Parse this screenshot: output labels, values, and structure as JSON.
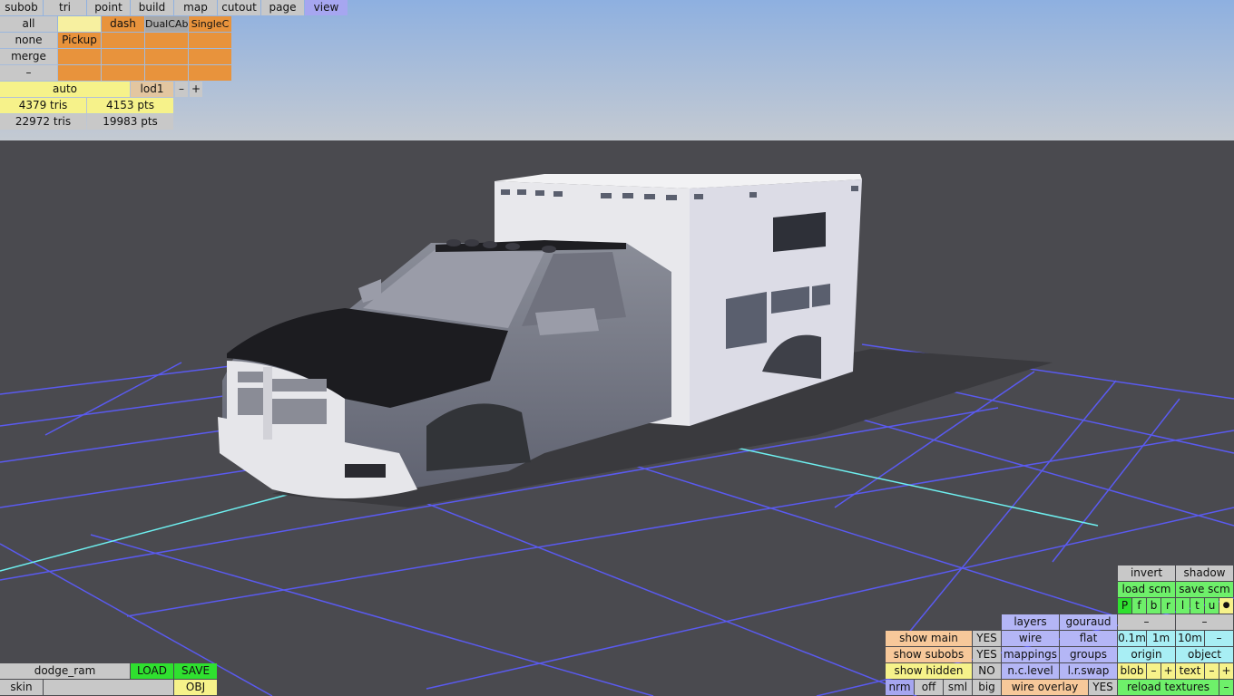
{
  "top_menu": [
    "subob",
    "tri",
    "point",
    "build",
    "map",
    "cutout",
    "page",
    "view"
  ],
  "subob_grid": {
    "row1": [
      "all",
      "",
      "dash",
      "DualCAb",
      "SingleC"
    ],
    "row2": [
      "none",
      "Pickup",
      "",
      "",
      ""
    ],
    "row3": [
      "merge",
      "",
      "",
      "",
      ""
    ],
    "row4": [
      "–",
      "",
      "",
      "",
      ""
    ]
  },
  "lod": {
    "mode": "auto",
    "level": "lod1",
    "minus": "–",
    "plus": "+"
  },
  "stats": {
    "tris_sel": "4379 tris",
    "pts_sel": "4153 pts",
    "tris_total": "22972 tris",
    "pts_total": "19983 pts"
  },
  "file": {
    "name": "dodge_ram",
    "load": "LOAD",
    "save": "SAVE",
    "skin": "skin",
    "skin_value": "",
    "format": "OBJ"
  },
  "right_panel": {
    "invert": "invert",
    "shadow": "shadow",
    "load_scm": "load scm",
    "save_scm": "save scm",
    "letters": [
      "P",
      "f",
      "b",
      "r",
      "l",
      "t",
      "u",
      "●"
    ],
    "layers": "layers",
    "gouraud": "gouraud",
    "dash1": "–",
    "dash2": "–",
    "show_main": "show main",
    "show_main_val": "YES",
    "wire": "wire",
    "flat": "flat",
    "scale_01": "0.1m",
    "scale_1": "1m",
    "scale_10": "10m",
    "scale_minus": "–",
    "show_subobs": "show subobs",
    "show_subobs_val": "YES",
    "mappings": "mappings",
    "groups": "groups",
    "origin": "origin",
    "object": "object",
    "show_hidden": "show hidden",
    "show_hidden_val": "NO",
    "nc_level": "n.c.level",
    "lr_swap": "l.r.swap",
    "blob": "blob",
    "blob_minus": "–",
    "blob_plus": "+",
    "text": "text",
    "text_minus": "–",
    "text_plus": "+",
    "nrm": "nrm",
    "off": "off",
    "sml": "sml",
    "big": "big",
    "wire_overlay": "wire overlay",
    "wire_overlay_val": "YES",
    "reload_textures": "reload textures",
    "reload_minus": "–"
  },
  "colors": {
    "sky_top": "#8eb0e0",
    "sky_bottom": "#c4cad2",
    "ground": "#4a4a4f",
    "grid": "#5a5af0",
    "axis": "#6ef0f0"
  }
}
